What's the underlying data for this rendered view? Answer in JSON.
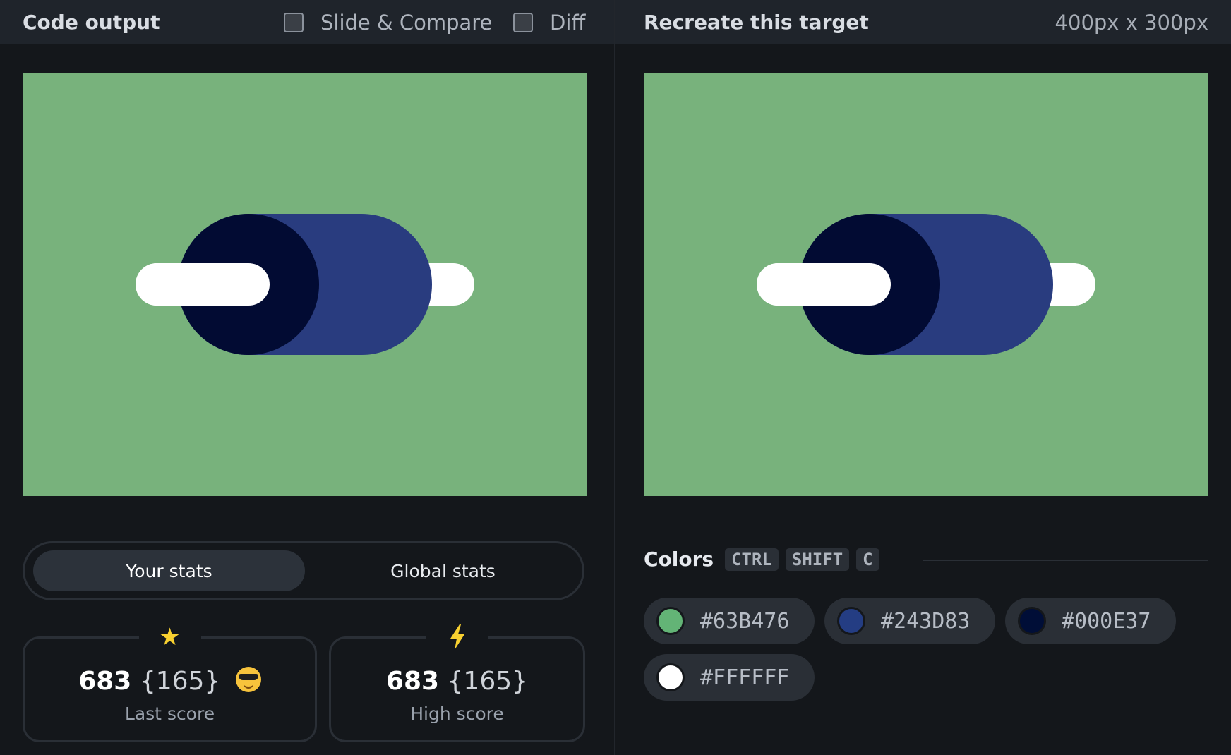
{
  "left_panel": {
    "title": "Code output",
    "slide_compare_label": "Slide & Compare",
    "diff_label": "Diff",
    "stats_tabs": {
      "your_stats": "Your stats",
      "global_stats": "Global stats"
    },
    "last_score": {
      "score": "683",
      "chars": "{165}",
      "label": "Last score",
      "icon": "star-icon",
      "emoji": "smiling-face-with-sunglasses-icon"
    },
    "high_score": {
      "score": "683",
      "chars": "{165}",
      "label": "High score",
      "icon": "lightning-icon"
    }
  },
  "right_panel": {
    "title": "Recreate this target",
    "dimensions": "400px x 300px",
    "colors_title": "Colors",
    "shortcut_keys": [
      "CTRL",
      "SHIFT",
      "C"
    ],
    "swatches": [
      {
        "hex": "#63B476",
        "color": "#63B476"
      },
      {
        "hex": "#243D83",
        "color": "#243D83"
      },
      {
        "hex": "#000E37",
        "color": "#000E37"
      },
      {
        "hex": "#FFFFFF",
        "color": "#FFFFFF"
      }
    ]
  },
  "palette": {
    "canvas_background": "#78B27C",
    "dark_navy": "#020B33",
    "navy": "#293C7F",
    "white": "#FFFFFF"
  }
}
